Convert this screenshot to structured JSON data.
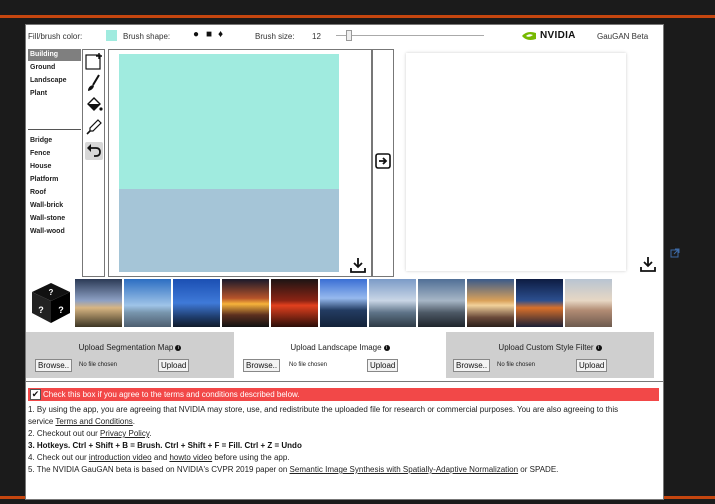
{
  "toolbar": {
    "fill_label": "Fill/brush color:",
    "fill_color": "#a0ebdf",
    "shape_label": "Brush shape:",
    "shapes": [
      "●",
      "■",
      "♦"
    ],
    "size_label": "Brush size:",
    "size_value": "12",
    "brand": "NVIDIA",
    "app_name": "GauGAN Beta"
  },
  "labels": {
    "group1": [
      "Building",
      "Ground",
      "Landscape",
      "Plant"
    ],
    "group2": [
      "Bridge",
      "Fence",
      "House",
      "Platform",
      "Roof",
      "Wall-brick",
      "Wall-stone",
      "Wall-wood"
    ],
    "selected": "Building"
  },
  "canvas": {
    "sky_color": "#a0ebdf",
    "ground_color": "#a5c5d7"
  },
  "uploads": {
    "segmentation": {
      "title": "Upload Segmentation Map",
      "browse": "Browse..",
      "nofile": "No file chosen",
      "upload": "Upload"
    },
    "landscape": {
      "title": "Upload Landscape Image",
      "browse": "Browse..",
      "nofile": "No file chosen",
      "upload": "Upload"
    },
    "style": {
      "title": "Upload Custom Style Filter",
      "browse": "Browse..",
      "nofile": "No file chosen",
      "upload": "Upload"
    }
  },
  "terms": {
    "agree": "Check this box if you agree to the terms and conditions described below.",
    "l1a": "1. By using the app, you are agreeing that NVIDIA may store, use, and redistribute the uploaded file for research or commercial purposes. You are also agreeing to this",
    "l1b_pre": "service ",
    "l1b_link": "Terms and Conditions",
    "l1b_post": ".",
    "l2_pre": "2. Checkout out our ",
    "l2_link": "Privacy Policy",
    "l2_post": ".",
    "l3": "3. Hotkeys. Ctrl + Shift + B = Brush. Ctrl + Shift + F = Fill. Ctrl + Z = Undo",
    "l4_pre": "4. Check out our ",
    "l4_link1": "introduction video",
    "l4_mid": " and ",
    "l4_link2": "howto video",
    "l4_post": " before using the app.",
    "l5_pre": "5. The NVIDIA GauGAN beta is based on NVIDIA's CVPR 2019 paper on ",
    "l5_link": "Semantic Image Synthesis with Spatially-Adaptive Normalization",
    "l5_post": " or SPADE."
  },
  "colors": {
    "accent_bar": "#c5460f",
    "agree_bar": "#f24848",
    "nvidia_green": "#76b900"
  }
}
